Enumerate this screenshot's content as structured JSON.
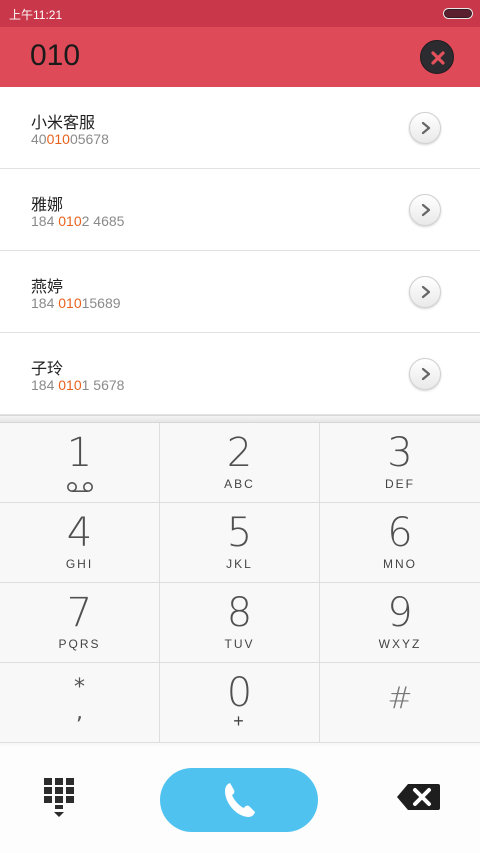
{
  "status_bar": {
    "time": "上午11:21"
  },
  "search": {
    "query": "010"
  },
  "results": [
    {
      "name": "小米客服",
      "number_pre": "40",
      "number_match": "010",
      "number_post": "05678"
    },
    {
      "name": "雅娜",
      "number_pre": "184 ",
      "number_match": "010",
      "number_post": "2 4685"
    },
    {
      "name": "燕婷",
      "number_pre": "184 ",
      "number_match": "010",
      "number_post": "15689"
    },
    {
      "name": "子玲",
      "number_pre": "184 ",
      "number_match": "010",
      "number_post": "1 5678"
    }
  ],
  "keypad": {
    "keys": [
      {
        "digit": "1",
        "letters": ""
      },
      {
        "digit": "2",
        "letters": "ABC"
      },
      {
        "digit": "3",
        "letters": "DEF"
      },
      {
        "digit": "4",
        "letters": "GHI"
      },
      {
        "digit": "5",
        "letters": "JKL"
      },
      {
        "digit": "6",
        "letters": "MNO"
      },
      {
        "digit": "7",
        "letters": "PQRS"
      },
      {
        "digit": "8",
        "letters": "TUV"
      },
      {
        "digit": "9",
        "letters": "WXYZ"
      },
      {
        "digit": "*",
        "letters": ","
      },
      {
        "digit": "0",
        "letters": "+"
      },
      {
        "digit": "#",
        "letters": ""
      }
    ]
  },
  "icons": {
    "clear": "close-icon",
    "detail": "chevron-right-icon",
    "voicemail": "voicemail-icon",
    "dialpad": "dialpad-icon",
    "call": "phone-icon",
    "backspace": "backspace-icon"
  },
  "colors": {
    "status_bar": "#c8384a",
    "search_bar": "#de4a57",
    "match_highlight": "#e8621e",
    "call_button": "#4fc2f0"
  }
}
